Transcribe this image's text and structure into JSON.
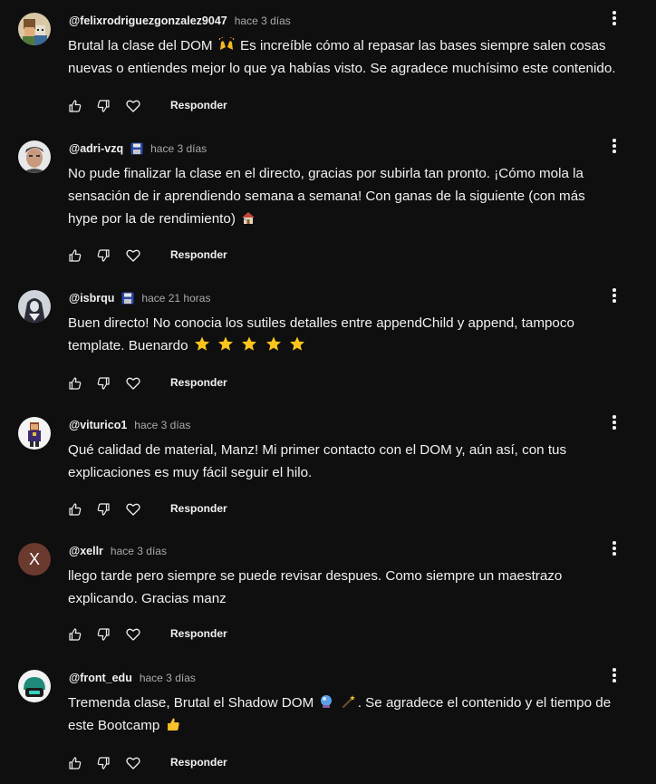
{
  "reply_label": "Responder",
  "comments": [
    {
      "handle": "@felixrodriguezgonzalez9047",
      "time": "hace 3 días",
      "lines": [
        "Brutal la clase del DOM",
        " Es increíble cómo al repasar las bases siempre salen cosas",
        "nuevas o entiendes mejor lo que ya habías visto. Se agradece muchísimo este contenido."
      ],
      "emojis": [
        "raising-hands-emoji"
      ]
    },
    {
      "handle": "@adri-vzq",
      "badge": "floppy-disk-icon",
      "time": "hace 3 días",
      "lines": [
        "No pude finalizar la clase en el directo, gracias por subirla tan pronto. ¡Cómo mola la",
        "sensación de ir aprendiendo semana a semana! Con ganas de la siguiente (con más",
        "hype por la de rendimiento)"
      ],
      "emojis": [
        "house-emoji"
      ]
    },
    {
      "handle": "@isbrqu",
      "badge": "floppy-disk-icon",
      "time": "hace 21 horas",
      "lines": [
        "Buen directo! No conocia los sutiles detalles entre appendChild y append, tampoco",
        "template. Buenardo"
      ],
      "emojis": [
        "star-emoji",
        "star-emoji",
        "star-emoji",
        "star-emoji",
        "star-emoji"
      ]
    },
    {
      "handle": "@viturico1",
      "time": "hace 3 días",
      "lines": [
        "Qué calidad de material, Manz! Mi primer contacto con el DOM y, aún así, con tus",
        "explicaciones es muy fácil seguir el hilo."
      ]
    },
    {
      "handle": "@xellr",
      "avatar_letter": "X",
      "time": "hace 3 días",
      "lines": [
        "llego tarde pero siempre se puede revisar despues. Como siempre un maestrazo",
        "explicando. Gracias manz"
      ]
    },
    {
      "handle": "@front_edu",
      "time": "hace 3 días",
      "lines": [
        "Tremenda clase, Brutal el Shadow DOM",
        ". Se agradece el contenido y el tiempo de",
        "este Bootcamp"
      ],
      "emojis": [
        "crystal-ball-emoji",
        "magic-wand-emoji",
        "thumbs-up-emoji"
      ]
    }
  ],
  "colors": {
    "background": "#0f0f0f",
    "text": "#f1f1f1",
    "secondary_text": "#aaaaaa",
    "avatar_x": "#6b3a2e"
  }
}
